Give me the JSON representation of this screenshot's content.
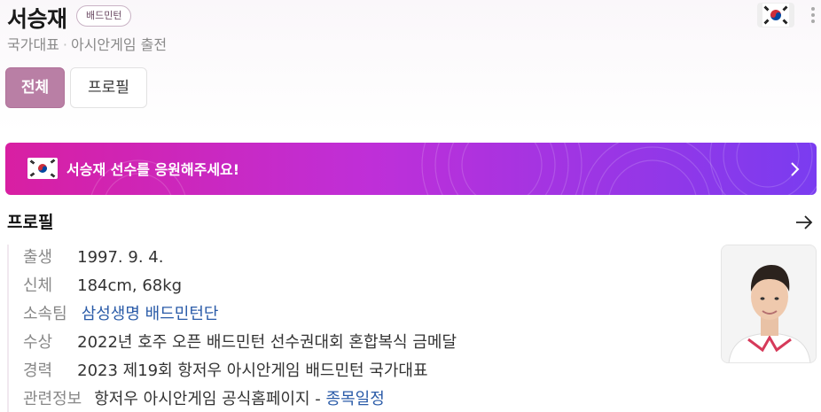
{
  "header": {
    "name": "서승재",
    "sport_badge": "배드민턴",
    "subtitle_part1": "국가대표",
    "subtitle_separator": "·",
    "subtitle_part2": "아시안게임 출전",
    "flag_icon": "korea-flag-icon",
    "more_icon": "more-vertical-icon"
  },
  "tabs": [
    {
      "label": "전체",
      "selected": true
    },
    {
      "label": "프로필",
      "selected": false
    }
  ],
  "banner": {
    "text": "서승재 선수를 응원해주세요!",
    "flag_icon": "korea-flag-icon",
    "chevron_icon": "chevron-right-icon",
    "gradient_colors": [
      "#d81fa2",
      "#bf2fd8",
      "#7a3cf0"
    ]
  },
  "profile": {
    "title": "프로필",
    "arrow_icon": "arrow-right-icon",
    "rows": [
      {
        "label": "출생",
        "value": "1997. 9. 4."
      },
      {
        "label": "신체",
        "value": "184cm, 68kg"
      },
      {
        "label": "소속팀",
        "value": "삼성생명 배드민턴단"
      },
      {
        "label": "수상",
        "value": "2022년 호주 오픈 배드민턴 선수권대회 혼합복식 금메달"
      },
      {
        "label": "경력",
        "value": "2023 제19회 항저우 아시안게임 배드민턴 국가대표"
      },
      {
        "label": "관련정보",
        "value": "항저우 아시안게임 공식홈페이지",
        "separator": "-",
        "link": "종목일정"
      }
    ],
    "photo_icon": "athlete-photo"
  },
  "colors": {
    "accent": "#b97fa5",
    "link": "#2a5ba8"
  }
}
